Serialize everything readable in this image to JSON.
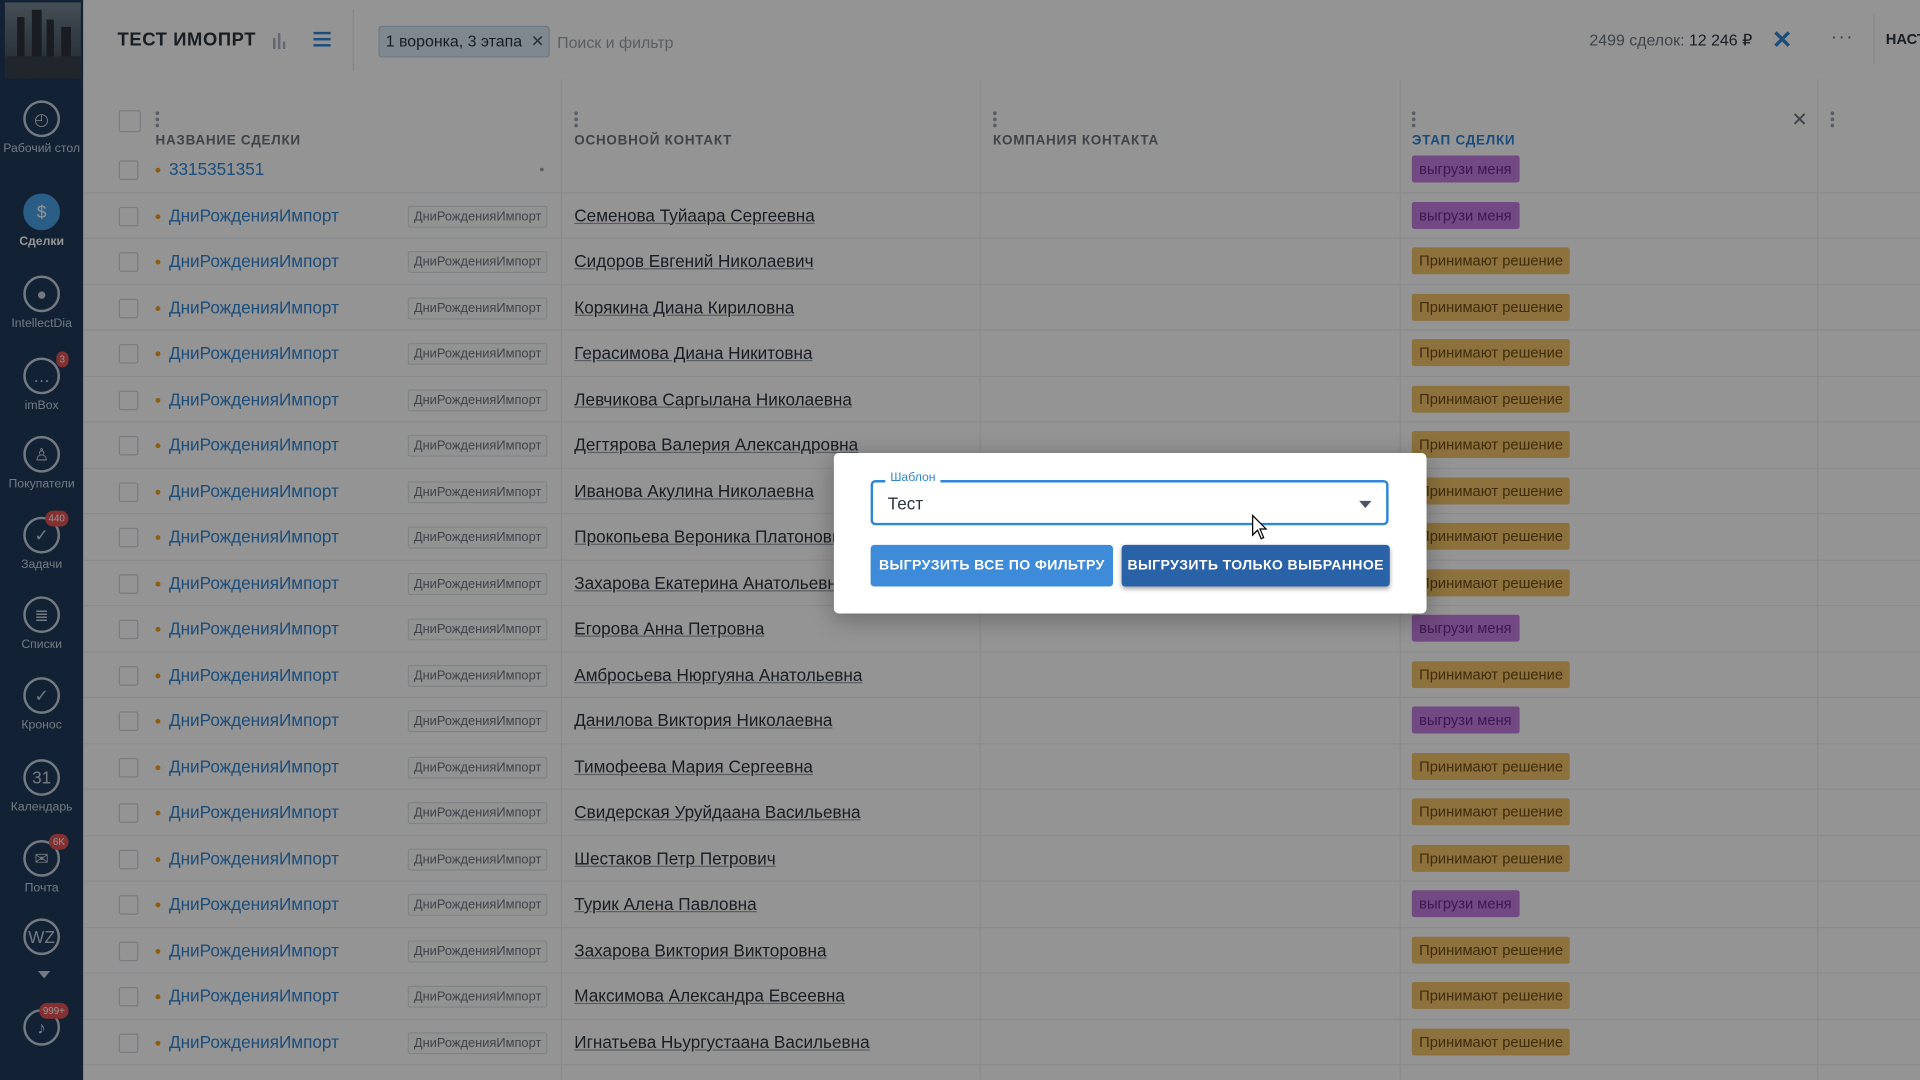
{
  "sidebar": {
    "items": [
      {
        "label": "Рабочий стол",
        "icon": "dashboard-icon",
        "glyph": "◴"
      },
      {
        "label": "Сделки",
        "icon": "deals-icon",
        "glyph": "$"
      },
      {
        "label": "IntellectDia",
        "icon": "intellect-icon",
        "glyph": "●"
      },
      {
        "label": "imBox",
        "icon": "chat-icon",
        "glyph": "…",
        "badge": "3"
      },
      {
        "label": "Покупатели",
        "icon": "customers-icon",
        "glyph": "♙"
      },
      {
        "label": "Задачи",
        "icon": "tasks-icon",
        "glyph": "✓",
        "badge": "440"
      },
      {
        "label": "Списки",
        "icon": "lists-icon",
        "glyph": "≣"
      },
      {
        "label": "Кронос",
        "icon": "kronos-icon",
        "glyph": "✓"
      },
      {
        "label": "Календарь",
        "icon": "calendar-icon",
        "glyph": "31"
      },
      {
        "label": "Почта",
        "icon": "mail-icon",
        "glyph": "✉",
        "badge": "6K"
      },
      {
        "label": "",
        "icon": "wz-icon",
        "glyph": "WZ"
      },
      {
        "label": "",
        "icon": "notifications-icon",
        "glyph": "♪",
        "badge": "999+"
      }
    ]
  },
  "header": {
    "title": "ТЕСТ ИМОПРТ",
    "filter_chip": "1 воронка, 3 этапа",
    "search_placeholder": "Поиск и фильтр",
    "deals_count": "2499 сделок:",
    "deals_amount": "12 246 ₽",
    "settings_label": "НАСТРОЙКИ"
  },
  "table": {
    "columns": [
      "НАЗВАНИЕ СДЕЛКИ",
      "ОСНОВНОЙ КОНТАКТ",
      "КОМПАНИЯ КОНТАКТА",
      "ЭТАП СДЕЛКИ"
    ],
    "rows": [
      {
        "deal": "3315351351",
        "tag": "",
        "contact": "",
        "stage": "выгрузи меня",
        "stage_color": "purple"
      },
      {
        "deal": "ДниРожденияИмпорт",
        "tag": "ДниРожденияИмпорт",
        "contact": "Семенова Туйаара Сергеевна",
        "stage": "выгрузи меня",
        "stage_color": "purple"
      },
      {
        "deal": "ДниРожденияИмпорт",
        "tag": "ДниРожденияИмпорт",
        "contact": "Сидоров Евгений Николаевич",
        "stage": "Принимают решение",
        "stage_color": "orange"
      },
      {
        "deal": "ДниРожденияИмпорт",
        "tag": "ДниРожденияИмпорт",
        "contact": "Корякина Диана Кириловна",
        "stage": "Принимают решение",
        "stage_color": "orange"
      },
      {
        "deal": "ДниРожденияИмпорт",
        "tag": "ДниРожденияИмпорт",
        "contact": "Герасимова Диана Никитовна",
        "stage": "Принимают решение",
        "stage_color": "orange"
      },
      {
        "deal": "ДниРожденияИмпорт",
        "tag": "ДниРожденияИмпорт",
        "contact": "Левчикова Саргылана Николаевна",
        "stage": "Принимают решение",
        "stage_color": "orange"
      },
      {
        "deal": "ДниРожденияИмпорт",
        "tag": "ДниРожденияИмпорт",
        "contact": "Дегтярова Валерия Александровна",
        "stage": "Принимают решение",
        "stage_color": "orange"
      },
      {
        "deal": "ДниРожденияИмпорт",
        "tag": "ДниРожденияИмпорт",
        "contact": "Иванова Акулина Николаевна",
        "stage": "Принимают решение",
        "stage_color": "orange"
      },
      {
        "deal": "ДниРожденияИмпорт",
        "tag": "ДниРожденияИмпорт",
        "contact": "Прокопьева Вероника Платоновна",
        "stage": "Принимают решение",
        "stage_color": "orange"
      },
      {
        "deal": "ДниРожденияИмпорт",
        "tag": "ДниРожденияИмпорт",
        "contact": "Захарова Екатерина Анатольевна",
        "stage": "Принимают решение",
        "stage_color": "orange"
      },
      {
        "deal": "ДниРожденияИмпорт",
        "tag": "ДниРожденияИмпорт",
        "contact": "Егорова Анна Петровна",
        "stage": "выгрузи меня",
        "stage_color": "purple"
      },
      {
        "deal": "ДниРожденияИмпорт",
        "tag": "ДниРожденияИмпорт",
        "contact": "Амбросьева Нюргуяна Анатольевна",
        "stage": "Принимают решение",
        "stage_color": "orange"
      },
      {
        "deal": "ДниРожденияИмпорт",
        "tag": "ДниРожденияИмпорт",
        "contact": "Данилова Виктория Николаевна",
        "stage": "выгрузи меня",
        "stage_color": "purple"
      },
      {
        "deal": "ДниРожденияИмпорт",
        "tag": "ДниРожденияИмпорт",
        "contact": "Тимофеева Мария Сергеевна",
        "stage": "Принимают решение",
        "stage_color": "orange"
      },
      {
        "deal": "ДниРожденияИмпорт",
        "tag": "ДниРожденияИмпорт",
        "contact": "Свидерская Уруйдаана Васильевна",
        "stage": "Принимают решение",
        "stage_color": "orange"
      },
      {
        "deal": "ДниРожденияИмпорт",
        "tag": "ДниРожденияИмпорт",
        "contact": "Шестаков Петр Петрович",
        "stage": "Принимают решение",
        "stage_color": "orange"
      },
      {
        "deal": "ДниРожденияИмпорт",
        "tag": "ДниРожденияИмпорт",
        "contact": "Турик Алена Павловна",
        "stage": "выгрузи меня",
        "stage_color": "purple"
      },
      {
        "deal": "ДниРожденияИмпорт",
        "tag": "ДниРожденияИмпорт",
        "contact": "Захарова Виктория Викторовна",
        "stage": "Принимают решение",
        "stage_color": "orange"
      },
      {
        "deal": "ДниРожденияИмпорт",
        "tag": "ДниРожденияИмпорт",
        "contact": "Максимова Александра Евсеевна",
        "stage": "Принимают решение",
        "stage_color": "orange"
      },
      {
        "deal": "ДниРожденияИмпорт",
        "tag": "ДниРожденияИмпорт",
        "contact": "Игнатьева Ньургустаана Васильевна",
        "stage": "Принимают решение",
        "stage_color": "orange"
      }
    ]
  },
  "modal": {
    "template_label": "Шаблон",
    "template_value": "Тест",
    "export_all_label": "ВЫГРУЗИТЬ ВСЕ ПО ФИЛЬТРУ",
    "export_selected_label": "ВЫГРУЗИТЬ ТОЛЬКО ВЫБРАННОЕ"
  },
  "colors": {
    "sidebar_bg": "#1f3b5b",
    "accent": "#2f86d6",
    "stage_purple": "#c57ee0",
    "stage_orange": "#f5c56a",
    "primary_button": "#3d8bd9",
    "secondary_button": "#2a62a8"
  }
}
